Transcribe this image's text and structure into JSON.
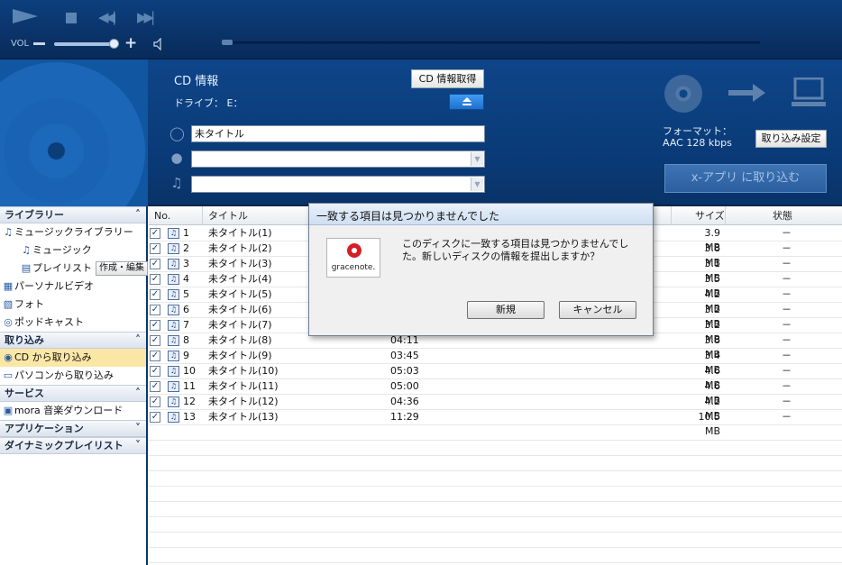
{
  "transport": {
    "vol_label": "VOL"
  },
  "cd_panel": {
    "title": "CD 情報",
    "drive_label": "ドライブ： E：",
    "get_info_button": "CD 情報取得",
    "album_title_value": "未タイトル",
    "artist_value": "",
    "genre_value": "",
    "format_label": "フォーマット：",
    "format_value": "AAC 128 kbps",
    "rip_settings_button": "取り込み設定",
    "rip_button": "x-アプリ に取り込む"
  },
  "sidebar": {
    "sections": [
      {
        "header": "ライブラリー",
        "expanded": true,
        "items": [
          {
            "label": "ミュージックライブラリー",
            "icon": "music-note-icon",
            "indent": 0
          },
          {
            "label": "ミュージック",
            "icon": "music-note-icon",
            "indent": 1
          },
          {
            "label": "プレイリスト",
            "icon": "playlist-icon",
            "indent": 1
          },
          {
            "label": "パーソナルビデオ",
            "icon": "film-icon",
            "indent": 0
          },
          {
            "label": "フォト",
            "icon": "photo-icon",
            "indent": 0
          },
          {
            "label": "ポッドキャスト",
            "icon": "podcast-icon",
            "indent": 0
          }
        ]
      },
      {
        "header": "取り込み",
        "expanded": true,
        "items": [
          {
            "label": "CD から取り込み",
            "icon": "cd-icon",
            "indent": 0,
            "selected": true
          },
          {
            "label": "パソコンから取り込み",
            "icon": "computer-icon",
            "indent": 0
          }
        ]
      },
      {
        "header": "サービス",
        "expanded": true,
        "items": [
          {
            "label": "mora 音楽ダウンロード",
            "icon": "mora-icon",
            "indent": 0
          }
        ]
      },
      {
        "header": "アプリケーション",
        "expanded": false,
        "items": []
      },
      {
        "header": "ダイナミックプレイリスト",
        "expanded": false,
        "items": []
      }
    ],
    "playlist_action_button": "作成・編集"
  },
  "tracklist": {
    "columns": [
      "No.",
      "タイトル",
      "サイズ",
      "状態"
    ],
    "rows": [
      {
        "no": "1",
        "title": "未タイトル(1)",
        "time": "",
        "size": "3.9 MB",
        "state": "－"
      },
      {
        "no": "2",
        "title": "未タイトル(2)",
        "time": "",
        "size": "3.8 MB",
        "state": "－"
      },
      {
        "no": "3",
        "title": "未タイトル(3)",
        "time": "",
        "size": "3.1 MB",
        "state": "－"
      },
      {
        "no": "4",
        "title": "未タイトル(4)",
        "time": "",
        "size": "3.5 MB",
        "state": "－"
      },
      {
        "no": "5",
        "title": "未タイトル(5)",
        "time": "",
        "size": "4.2 MB",
        "state": "－"
      },
      {
        "no": "6",
        "title": "未タイトル(6)",
        "time": "",
        "size": "3.2 MB",
        "state": "－"
      },
      {
        "no": "7",
        "title": "未タイトル(7)",
        "time": "",
        "size": "3.2 MB",
        "state": "－"
      },
      {
        "no": "8",
        "title": "未タイトル(8)",
        "time": "04:11",
        "size": "3.8 MB",
        "state": "－"
      },
      {
        "no": "9",
        "title": "未タイトル(9)",
        "time": "03:45",
        "size": "3.4 MB",
        "state": "－"
      },
      {
        "no": "10",
        "title": "未タイトル(10)",
        "time": "05:03",
        "size": "4.6 MB",
        "state": "－"
      },
      {
        "no": "11",
        "title": "未タイトル(11)",
        "time": "05:00",
        "size": "4.6 MB",
        "state": "－"
      },
      {
        "no": "12",
        "title": "未タイトル(12)",
        "time": "04:36",
        "size": "4.2 MB",
        "state": "－"
      },
      {
        "no": "13",
        "title": "未タイトル(13)",
        "time": "11:29",
        "size": "10.5 MB",
        "state": "－"
      }
    ]
  },
  "dialog": {
    "title": "一致する項目は見つかりませんでした",
    "logo_text": "gracenote.",
    "message": "このディスクに一致する項目は見つかりませんでした。新しいディスクの情報を提出しますか？",
    "new_button": "新規",
    "cancel_button": "キャンセル"
  }
}
